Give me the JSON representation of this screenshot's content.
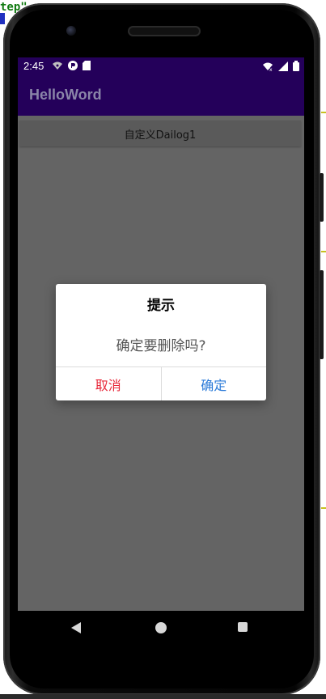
{
  "ide": {
    "fragment": "tep\""
  },
  "status_bar": {
    "time": "2:45",
    "left_icons": [
      "wifi-icon",
      "notification-icon",
      "sd-card-icon"
    ],
    "right_icons": [
      "wifi-signal-icon",
      "cell-signal-icon",
      "battery-icon"
    ]
  },
  "app_bar": {
    "title": "HelloWord"
  },
  "main": {
    "button_label": "自定义Dailog1"
  },
  "dialog": {
    "title": "提示",
    "message": "确定要删除吗?",
    "cancel_label": "取消",
    "confirm_label": "确定"
  },
  "nav_bar": {
    "icons": [
      "back-icon",
      "home-icon",
      "recents-icon"
    ]
  },
  "colors": {
    "app_bar": "#24005a",
    "cancel": "#e8283a",
    "confirm": "#2a7ad8",
    "content_bg": "#646464"
  }
}
